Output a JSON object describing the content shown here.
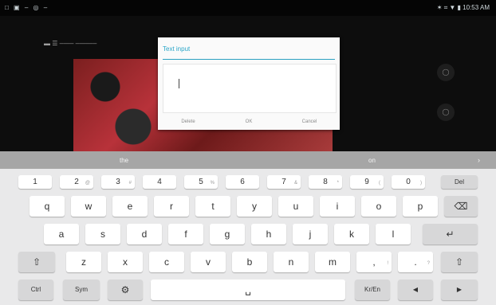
{
  "status_bar": {
    "left_icons": "□ ▣ – ◎ –",
    "right_text": "✶ ⌗ ▼ ▮ 10:53 AM"
  },
  "app": {
    "toolbar_text": "▬  ☰  ––––  ––––––"
  },
  "dialog": {
    "title": "Text input",
    "buttons": [
      "Delete",
      "OK",
      "Cancel"
    ]
  },
  "keyboard": {
    "suggestions": [
      "the",
      "on"
    ],
    "suggestion_arrow": "›",
    "number_row": [
      {
        "label": "1",
        "hint": ""
      },
      {
        "label": "2",
        "hint": "@"
      },
      {
        "label": "3",
        "hint": "#"
      },
      {
        "label": "4",
        "hint": ""
      },
      {
        "label": "5",
        "hint": "%"
      },
      {
        "label": "6",
        "hint": ""
      },
      {
        "label": "7",
        "hint": "&"
      },
      {
        "label": "8",
        "hint": "*"
      },
      {
        "label": "9",
        "hint": "("
      },
      {
        "label": "0",
        "hint": ")"
      }
    ],
    "del_label": "Del",
    "row_q": [
      "q",
      "w",
      "e",
      "r",
      "t",
      "y",
      "u",
      "i",
      "o",
      "p"
    ],
    "backspace_icon": "⌫",
    "row_a": [
      "a",
      "s",
      "d",
      "f",
      "g",
      "h",
      "j",
      "k",
      "l"
    ],
    "enter_icon": "↵",
    "row_z": [
      "z",
      "x",
      "c",
      "v",
      "b",
      "n",
      "m"
    ],
    "shift_icon": "⇧",
    "comma_label": ",",
    "comma_hint": "!",
    "period_label": ".",
    "period_hint": "?",
    "ctrl_label": "Ctrl",
    "sym_label": "Sym",
    "settings_icon": "⚙",
    "space_icon": "␣",
    "lang_label": "Kr/En",
    "left_icon": "◀",
    "right_icon": "▶"
  }
}
